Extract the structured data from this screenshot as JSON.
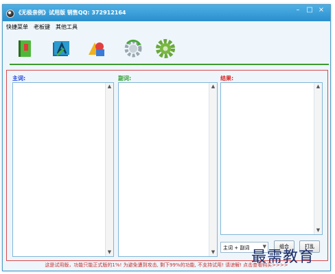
{
  "window": {
    "title": "《无极亲例》试用版 销售QQ: 372912164",
    "controls": {
      "minimize": "–",
      "maximize": "□",
      "close": "×"
    }
  },
  "menu": {
    "items": [
      "快捷菜单",
      "老板键",
      "其他工具"
    ]
  },
  "toolbar": {
    "icons": [
      "book-icon",
      "text-a-icon",
      "shapes-icon",
      "gear-refresh-icon",
      "gear-icon"
    ]
  },
  "panes": {
    "main_label": "主词:",
    "sub_label": "副词:",
    "result_label": "结果:"
  },
  "controls": {
    "combo_value": "主词 + 副词",
    "combine_label": "组合",
    "shuffle_label": "打乱"
  },
  "footer": {
    "notice": "这是试用版，功能只能正式版的1%! 为避免遭到攻击, 剩下99%的功能, 不支持试用! 请谅解! 点击查看购买>>>>"
  },
  "watermark": {
    "text": "最需教育"
  },
  "colors": {
    "titlebar": "#2a8fcf",
    "accent_red": "#d84a4a",
    "accent_green": "#3c9a2e"
  }
}
